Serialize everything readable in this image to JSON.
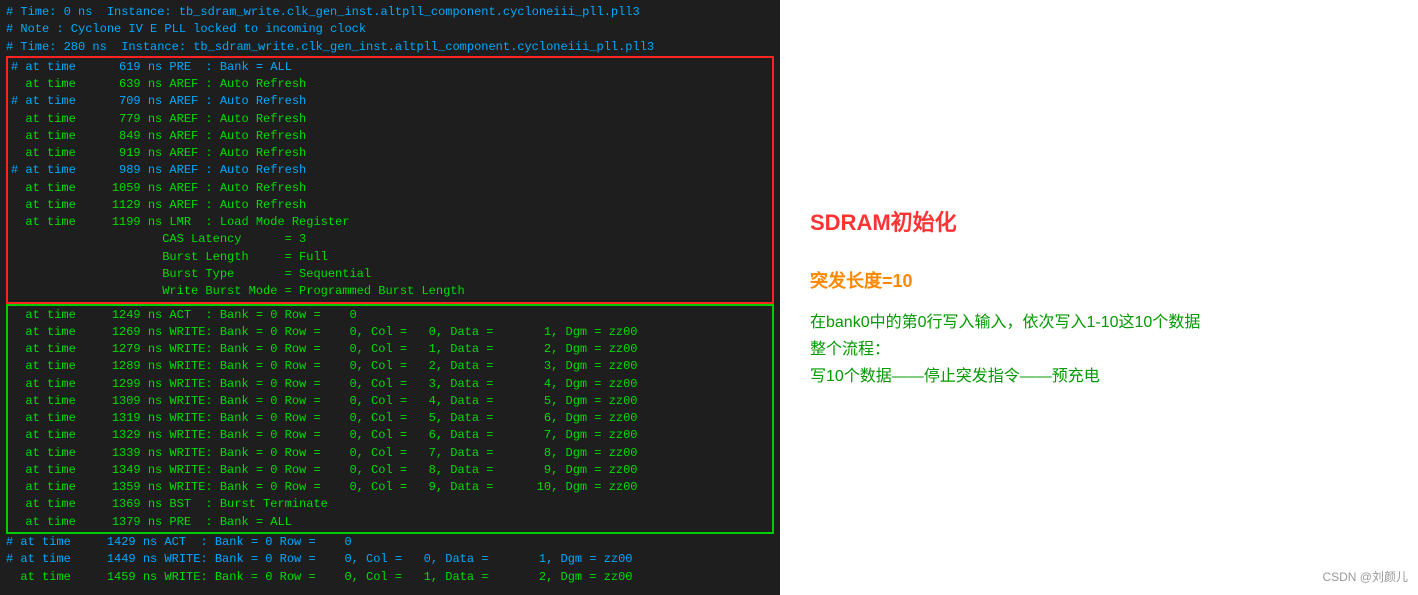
{
  "left": {
    "header_lines": [
      "# Time: 0 ns  Instance: tb_sdram_write.clk_gen_inst.altpll_component.cycloneiii_pll.pll3",
      "# Note : Cyclone IV E PLL locked to incoming clock",
      "# Time: 280 ns  Instance: tb_sdram_write.clk_gen_inst.altpll_component.cycloneiii_pll.pll3"
    ],
    "init_section": [
      "# at time      619 ns PRE  : Bank = ALL",
      "  at time      639 ns AREF : Auto Refresh",
      "# at time      709 ns AREF : Auto Refresh",
      "  at time      779 ns AREF : Auto Refresh",
      "  at time      849 ns AREF : Auto Refresh",
      "  at time      919 ns AREF : Auto Refresh",
      "# at time      989 ns AREF : Auto Refresh",
      "  at time     1059 ns AREF : Auto Refresh",
      "  at time     1129 ns AREF : Auto Refresh",
      "  at time     1199 ns LMR  : Load Mode Register",
      "                     CAS Latency      = 3",
      "                     Burst Length     = Full",
      "                     Burst Type       = Sequential",
      "                     Write Burst Mode = Programmed Burst Length"
    ],
    "write_section": [
      "  at time     1249 ns ACT  : Bank = 0 Row =    0",
      "  at time     1269 ns WRITE: Bank = 0 Row =    0, Col =   0, Data =       1, Dgm = zz00",
      "  at time     1279 ns WRITE: Bank = 0 Row =    0, Col =   1, Data =       2, Dgm = zz00",
      "  at time     1289 ns WRITE: Bank = 0 Row =    0, Col =   2, Data =       3, Dgm = zz00",
      "  at time     1299 ns WRITE: Bank = 0 Row =    0, Col =   3, Data =       4, Dgm = zz00",
      "  at time     1309 ns WRITE: Bank = 0 Row =    0, Col =   4, Data =       5, Dgm = zz00",
      "  at time     1319 ns WRITE: Bank = 0 Row =    0, Col =   5, Data =       6, Dgm = zz00",
      "  at time     1329 ns WRITE: Bank = 0 Row =    0, Col =   6, Data =       7, Dgm = zz00",
      "  at time     1339 ns WRITE: Bank = 0 Row =    0, Col =   7, Data =       8, Dgm = zz00",
      "  at time     1349 ns WRITE: Bank = 0 Row =    0, Col =   8, Data =       9, Dgm = zz00",
      "  at time     1359 ns WRITE: Bank = 0 Row =    0, Col =   9, Data =      10, Dgm = zz00",
      "  at time     1369 ns BST  : Burst Terminate",
      "  at time     1379 ns PRE  : Bank = ALL",
      "# at time     1429 ns ACT  : Bank = 0 Row =    0",
      "# at time     1449 ns WRITE: Bank = 0 Row =    0, Col =   0, Data =       1, Dgm = zz00",
      "  at time     1459 ns WRITE: Bank = 0 Row =    0, Col =   1, Data =       2, Dgm = zz00"
    ]
  },
  "right": {
    "title": "SDRAM初始化",
    "burst_label": "突发长度=10",
    "desc_line1": "在bank0中的第0行写入输入，依次写入1-10这10个数据",
    "desc_line2": "整个流程：",
    "desc_line3": "写10个数据——停止突发指令——预充电",
    "watermark": "CSDN @刘颜儿"
  }
}
